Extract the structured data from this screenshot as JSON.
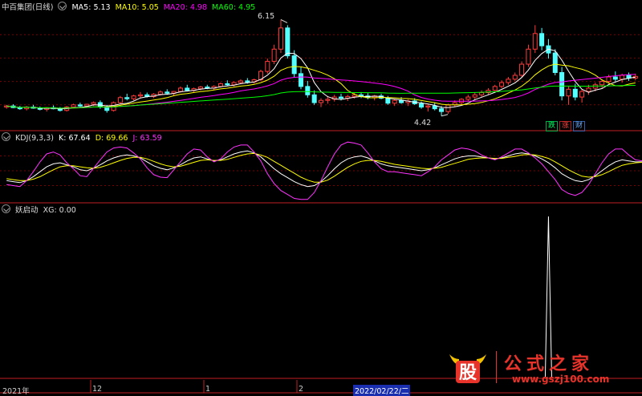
{
  "header_main": {
    "name": "中百集团(日线)",
    "ma5": "MA5: 5.13",
    "ma10": "MA10: 5.05",
    "ma20": "MA20: 4.98",
    "ma60": "MA60: 4.95",
    "high_label": "6.15",
    "low_label": "4.42",
    "btn_down": "跌",
    "btn_up": "涨",
    "btn_fin": "财"
  },
  "header_kdj": {
    "name": "KDJ(9,3,3)",
    "k": "K: 67.64",
    "d": "D: 69.66",
    "j": "J: 63.59"
  },
  "header_xg": {
    "name": "妖启动",
    "xg": "XG: 0.00"
  },
  "time_axis": {
    "year": "2021年",
    "m12": "12",
    "m1": "1",
    "m2": "2",
    "cursor_date": "2022/02/22/二"
  },
  "watermark": {
    "logo_char": "股",
    "title": "公式之家",
    "url": "www.gszj100.com"
  },
  "colors": {
    "up": "#ff3b3b",
    "down": "#54ffff",
    "ma5": "#ffffff",
    "ma10": "#ffff00",
    "ma20": "#ff00ff",
    "ma60": "#00ff00",
    "grid": "#7a0000",
    "divider": "#c02020"
  },
  "chart_data": [
    {
      "type": "candlestick",
      "title": "中百集团(日线)",
      "ylim": [
        4.2,
        6.3
      ],
      "high_marker": 6.15,
      "low_marker": 4.42,
      "series": [
        {
          "name": "MA5",
          "color": "#ffffff"
        },
        {
          "name": "MA10",
          "color": "#ffff00"
        },
        {
          "name": "MA20",
          "color": "#ff00ff"
        },
        {
          "name": "MA60",
          "color": "#00ff00"
        }
      ],
      "ohlc": [
        [
          4.58,
          4.62,
          4.55,
          4.6
        ],
        [
          4.6,
          4.63,
          4.56,
          4.57
        ],
        [
          4.57,
          4.6,
          4.53,
          4.55
        ],
        [
          4.55,
          4.6,
          4.52,
          4.58
        ],
        [
          4.58,
          4.62,
          4.55,
          4.56
        ],
        [
          4.56,
          4.59,
          4.52,
          4.54
        ],
        [
          4.54,
          4.58,
          4.5,
          4.57
        ],
        [
          4.57,
          4.61,
          4.54,
          4.55
        ],
        [
          4.55,
          4.58,
          4.5,
          4.52
        ],
        [
          4.52,
          4.6,
          4.5,
          4.58
        ],
        [
          4.58,
          4.64,
          4.56,
          4.62
        ],
        [
          4.62,
          4.66,
          4.58,
          4.6
        ],
        [
          4.6,
          4.64,
          4.57,
          4.63
        ],
        [
          4.63,
          4.68,
          4.6,
          4.66
        ],
        [
          4.66,
          4.7,
          4.55,
          4.58
        ],
        [
          4.58,
          4.62,
          4.48,
          4.52
        ],
        [
          4.52,
          4.68,
          4.5,
          4.66
        ],
        [
          4.66,
          4.78,
          4.64,
          4.75
        ],
        [
          4.75,
          4.82,
          4.7,
          4.73
        ],
        [
          4.73,
          4.8,
          4.7,
          4.78
        ],
        [
          4.78,
          4.85,
          4.74,
          4.8
        ],
        [
          4.8,
          4.84,
          4.75,
          4.77
        ],
        [
          4.77,
          4.83,
          4.74,
          4.81
        ],
        [
          4.81,
          4.88,
          4.79,
          4.85
        ],
        [
          4.85,
          4.9,
          4.8,
          4.83
        ],
        [
          4.83,
          4.87,
          4.79,
          4.86
        ],
        [
          4.86,
          4.95,
          4.84,
          4.92
        ],
        [
          4.92,
          4.98,
          4.86,
          4.88
        ],
        [
          4.88,
          4.93,
          4.85,
          4.91
        ],
        [
          4.91,
          4.96,
          4.88,
          4.94
        ],
        [
          4.94,
          4.98,
          4.9,
          4.92
        ],
        [
          4.92,
          4.97,
          4.89,
          4.95
        ],
        [
          4.95,
          5.02,
          4.93,
          5.0
        ],
        [
          5.0,
          5.06,
          4.96,
          4.98
        ],
        [
          4.98,
          5.04,
          4.95,
          5.02
        ],
        [
          5.02,
          5.08,
          4.99,
          5.05
        ],
        [
          5.05,
          5.1,
          5.0,
          5.03
        ],
        [
          5.03,
          5.09,
          5.0,
          5.07
        ],
        [
          5.07,
          5.25,
          5.05,
          5.22
        ],
        [
          5.22,
          5.45,
          5.18,
          5.4
        ],
        [
          5.4,
          5.7,
          5.35,
          5.62
        ],
        [
          5.62,
          6.15,
          5.55,
          6.0
        ],
        [
          6.0,
          6.05,
          5.45,
          5.5
        ],
        [
          5.5,
          5.6,
          5.12,
          5.18
        ],
        [
          5.18,
          5.3,
          4.9,
          4.95
        ],
        [
          4.95,
          5.05,
          4.75,
          4.8
        ],
        [
          4.8,
          4.88,
          4.62,
          4.66
        ],
        [
          4.66,
          4.74,
          4.58,
          4.7
        ],
        [
          4.7,
          4.78,
          4.64,
          4.72
        ],
        [
          4.72,
          4.8,
          4.68,
          4.76
        ],
        [
          4.76,
          4.82,
          4.7,
          4.74
        ],
        [
          4.74,
          4.8,
          4.69,
          4.77
        ],
        [
          4.77,
          4.84,
          4.73,
          4.8
        ],
        [
          4.8,
          4.85,
          4.74,
          4.78
        ],
        [
          4.78,
          4.83,
          4.72,
          4.75
        ],
        [
          4.75,
          4.8,
          4.7,
          4.78
        ],
        [
          4.78,
          4.82,
          4.72,
          4.74
        ],
        [
          4.74,
          4.78,
          4.62,
          4.65
        ],
        [
          4.65,
          4.72,
          4.6,
          4.7
        ],
        [
          4.7,
          4.76,
          4.64,
          4.66
        ],
        [
          4.66,
          4.72,
          4.6,
          4.69
        ],
        [
          4.69,
          4.74,
          4.62,
          4.64
        ],
        [
          4.64,
          4.68,
          4.55,
          4.58
        ],
        [
          4.58,
          4.64,
          4.5,
          4.6
        ],
        [
          4.6,
          4.66,
          4.52,
          4.55
        ],
        [
          4.55,
          4.6,
          4.42,
          4.5
        ],
        [
          4.5,
          4.64,
          4.46,
          4.62
        ],
        [
          4.62,
          4.7,
          4.58,
          4.66
        ],
        [
          4.66,
          4.74,
          4.62,
          4.72
        ],
        [
          4.72,
          4.8,
          4.68,
          4.76
        ],
        [
          4.76,
          4.84,
          4.72,
          4.8
        ],
        [
          4.8,
          4.88,
          4.76,
          4.84
        ],
        [
          4.84,
          4.92,
          4.8,
          4.88
        ],
        [
          4.88,
          4.98,
          4.86,
          4.95
        ],
        [
          4.95,
          5.06,
          4.92,
          5.02
        ],
        [
          5.02,
          5.12,
          4.98,
          5.08
        ],
        [
          5.08,
          5.2,
          5.05,
          5.15
        ],
        [
          5.15,
          5.4,
          5.12,
          5.35
        ],
        [
          5.35,
          5.7,
          5.3,
          5.62
        ],
        [
          5.62,
          6.05,
          5.55,
          5.9
        ],
        [
          5.9,
          6.0,
          5.6,
          5.68
        ],
        [
          5.68,
          5.8,
          5.45,
          5.55
        ],
        [
          5.55,
          5.62,
          5.15,
          5.2
        ],
        [
          5.2,
          5.3,
          4.7,
          4.78
        ],
        [
          4.78,
          4.95,
          4.62,
          4.9
        ],
        [
          4.9,
          5.0,
          4.7,
          4.76
        ],
        [
          4.76,
          4.9,
          4.66,
          4.86
        ],
        [
          4.86,
          4.98,
          4.8,
          4.92
        ],
        [
          4.92,
          5.02,
          4.86,
          4.98
        ],
        [
          4.98,
          5.08,
          4.92,
          5.04
        ],
        [
          5.04,
          5.16,
          5.0,
          5.12
        ],
        [
          5.12,
          5.22,
          5.04,
          5.08
        ],
        [
          5.08,
          5.18,
          5.02,
          5.15
        ],
        [
          5.15,
          5.2,
          5.05,
          5.1
        ],
        [
          5.1,
          5.18,
          5.06,
          5.13
        ]
      ]
    },
    {
      "type": "line",
      "title": "KDJ(9,3,3)",
      "ylim": [
        -10,
        110
      ],
      "series": [
        {
          "name": "K",
          "color": "#ffffff",
          "values": [
            30,
            28,
            26,
            30,
            38,
            48,
            58,
            64,
            66,
            62,
            58,
            52,
            50,
            55,
            62,
            70,
            76,
            80,
            82,
            80,
            76,
            68,
            60,
            55,
            52,
            56,
            62,
            70,
            76,
            78,
            74,
            70,
            72,
            78,
            84,
            88,
            90,
            86,
            78,
            66,
            54,
            44,
            36,
            28,
            22,
            18,
            20,
            28,
            40,
            54,
            66,
            74,
            78,
            80,
            76,
            70,
            64,
            60,
            58,
            56,
            54,
            52,
            50,
            52,
            56,
            62,
            68,
            74,
            78,
            80,
            80,
            78,
            76,
            74,
            76,
            80,
            84,
            86,
            84,
            80,
            74,
            66,
            56,
            44,
            36,
            30,
            28,
            32,
            40,
            50,
            60,
            68,
            72,
            70,
            68,
            68
          ]
        },
        {
          "name": "D",
          "color": "#ffff00",
          "values": [
            34,
            32,
            30,
            30,
            33,
            38,
            45,
            52,
            58,
            60,
            60,
            58,
            56,
            55,
            57,
            61,
            66,
            71,
            75,
            77,
            77,
            74,
            69,
            64,
            60,
            58,
            59,
            63,
            67,
            71,
            72,
            71,
            71,
            73,
            77,
            81,
            84,
            85,
            82,
            77,
            69,
            61,
            53,
            45,
            37,
            31,
            27,
            27,
            31,
            39,
            48,
            57,
            64,
            69,
            71,
            71,
            69,
            66,
            63,
            61,
            59,
            57,
            55,
            54,
            55,
            57,
            61,
            65,
            69,
            73,
            75,
            76,
            76,
            75,
            75,
            77,
            79,
            82,
            83,
            82,
            79,
            75,
            68,
            60,
            52,
            45,
            39,
            37,
            38,
            42,
            48,
            55,
            61,
            64,
            66,
            67
          ]
        },
        {
          "name": "J",
          "color": "#ff33ff",
          "values": [
            22,
            20,
            18,
            30,
            48,
            68,
            84,
            88,
            82,
            66,
            54,
            40,
            38,
            55,
            72,
            88,
            96,
            98,
            96,
            86,
            74,
            56,
            42,
            37,
            36,
            52,
            68,
            84,
            94,
            92,
            78,
            68,
            74,
            88,
            98,
            102,
            102,
            88,
            70,
            44,
            24,
            10,
            2,
            -6,
            -8,
            -8,
            6,
            30,
            58,
            84,
            102,
            108,
            106,
            102,
            86,
            68,
            54,
            48,
            48,
            46,
            44,
            42,
            40,
            48,
            58,
            72,
            82,
            92,
            96,
            94,
            90,
            82,
            76,
            72,
            78,
            86,
            94,
            94,
            86,
            76,
            64,
            48,
            32,
            12,
            4,
            0,
            6,
            22,
            44,
            66,
            84,
            94,
            94,
            82,
            72,
            70
          ]
        }
      ]
    },
    {
      "type": "bar",
      "title": "妖启动",
      "series": [
        {
          "name": "XG",
          "color": "#ffffff"
        }
      ],
      "ylim": [
        0,
        1
      ],
      "signal_index": 81,
      "value": 1
    }
  ]
}
